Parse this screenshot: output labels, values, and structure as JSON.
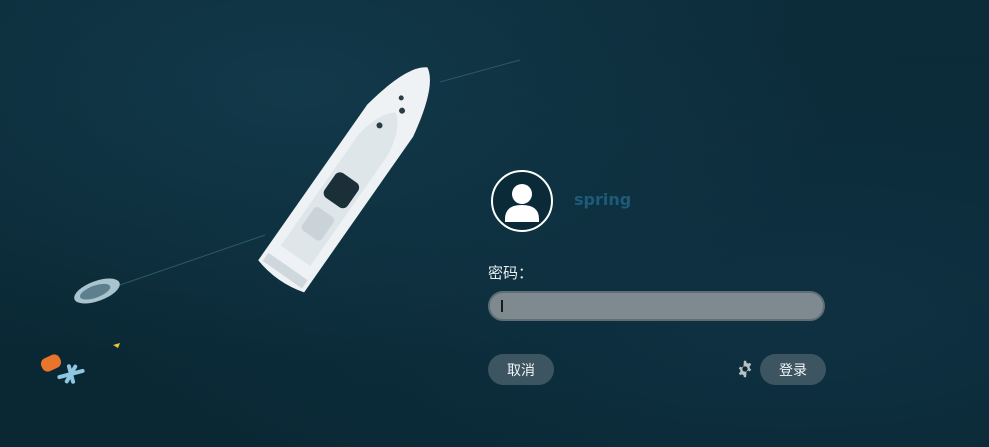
{
  "user": {
    "name": "spring",
    "avatar_icon": "user-avatar-icon"
  },
  "password": {
    "label": "密码：",
    "value": ""
  },
  "buttons": {
    "cancel": "取消",
    "login": "登录"
  },
  "icons": {
    "settings": "gear-icon"
  },
  "colors": {
    "background": "#0b2a37",
    "username": "#1e5a79",
    "button_bg": "#3c5560",
    "field_bg": "#7e8a8f"
  }
}
